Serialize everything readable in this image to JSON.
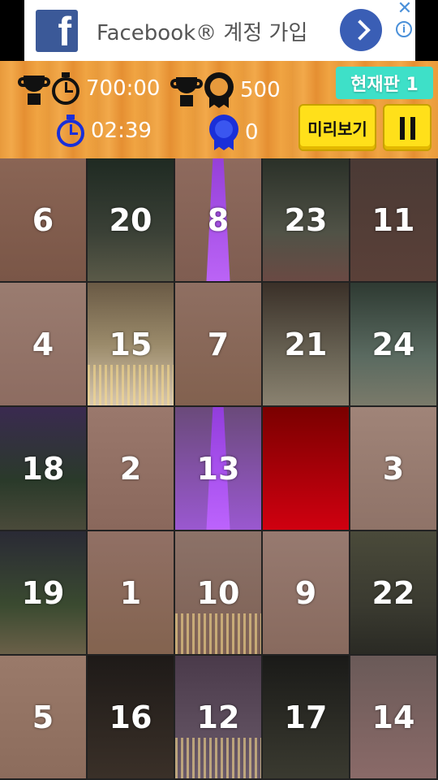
{
  "ad": {
    "text": "Facebook® 계정 가입",
    "logo_letter": "f",
    "close_glyph": "✕",
    "info_glyph": "i"
  },
  "stats": {
    "best_time": "700:00",
    "best_score": "500",
    "current_time": "02:39",
    "current_score": "0"
  },
  "current_board_label": "현재판  1",
  "preview_label": "미리보기",
  "icons": [
    "trophy-icon",
    "clock-icon",
    "medal-icon",
    "pause-icon"
  ],
  "colors": {
    "accent_cyan": "#3ee0c8",
    "button_yellow": "#ffe01a",
    "blue_icon": "#1a2fd8"
  },
  "tiles": [
    [
      "6",
      "20",
      "8",
      "23",
      "11"
    ],
    [
      "4",
      "15",
      "7",
      "21",
      "24"
    ],
    [
      "18",
      "2",
      "13",
      "",
      "3"
    ],
    [
      "19",
      "1",
      "10",
      "9",
      "22"
    ],
    [
      "5",
      "16",
      "12",
      "17",
      "14"
    ]
  ]
}
